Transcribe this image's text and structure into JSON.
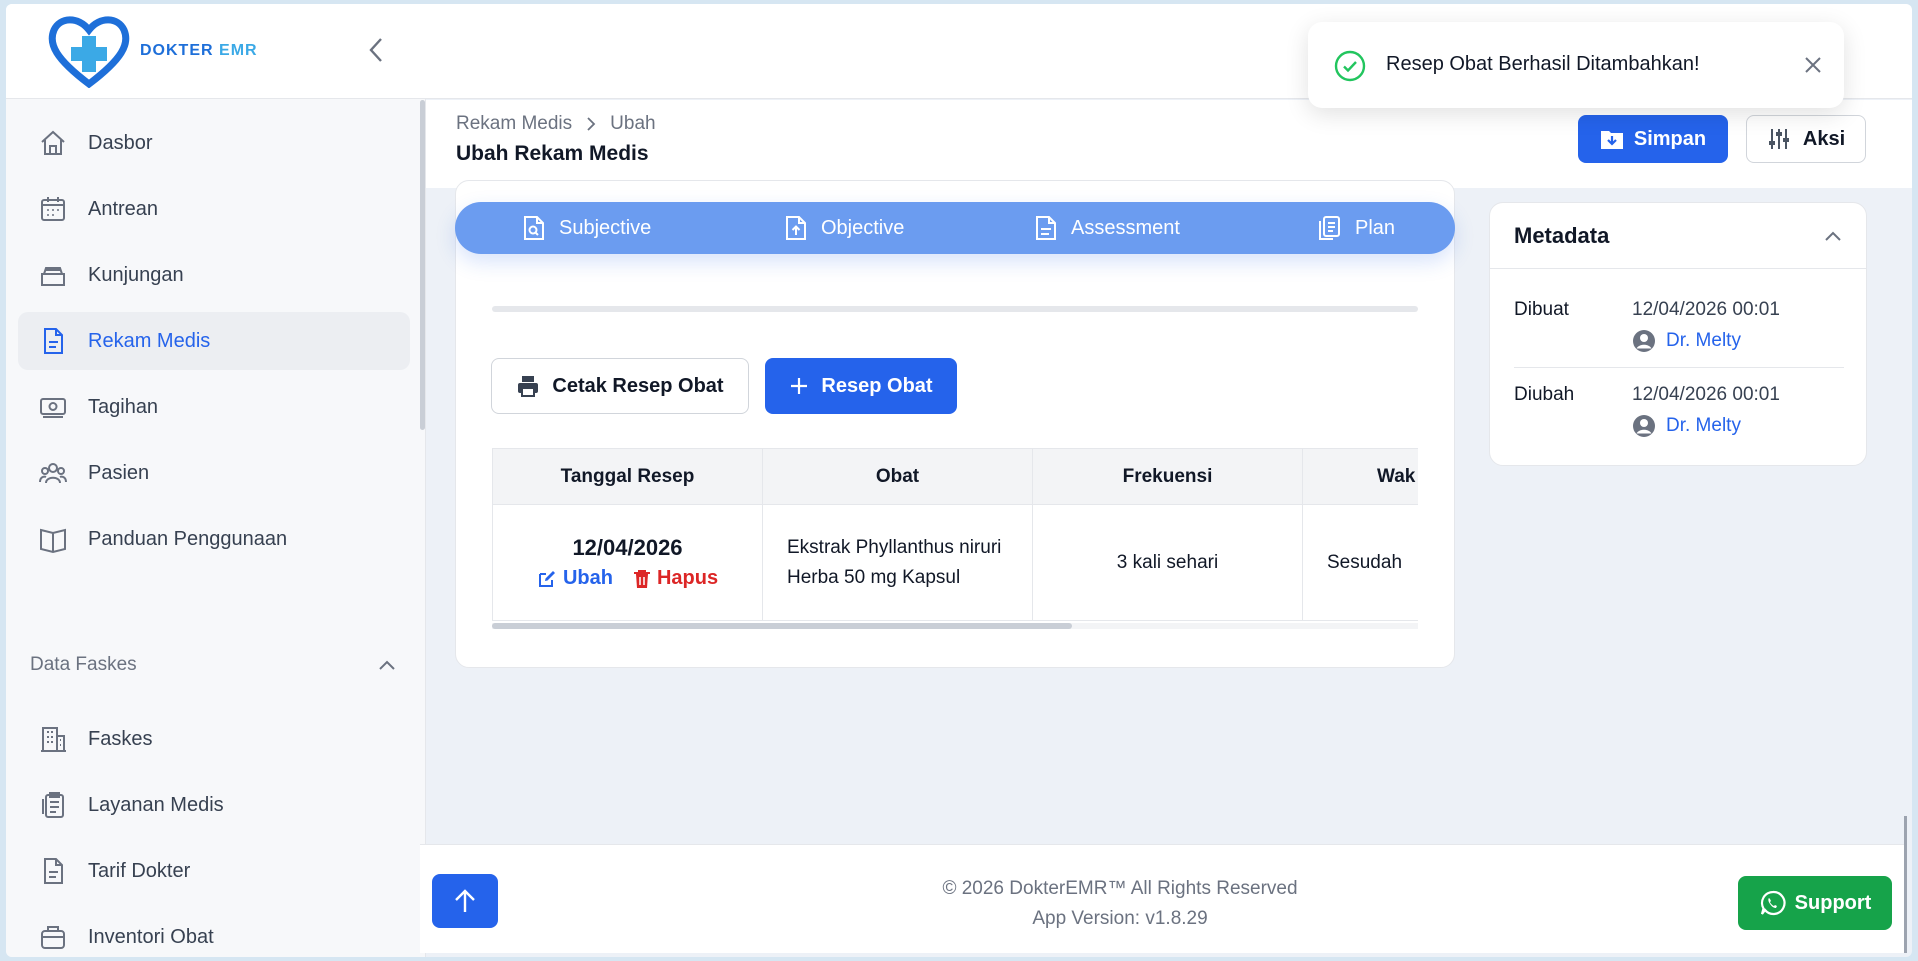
{
  "app": {
    "logo_text_main": "DOKTER",
    "logo_text_accent": "EMR"
  },
  "sidebar": {
    "items": [
      {
        "label": "Dasbor",
        "icon": "home-icon"
      },
      {
        "label": "Antrean",
        "icon": "calendar-icon"
      },
      {
        "label": "Kunjungan",
        "icon": "inbox-icon"
      },
      {
        "label": "Rekam Medis",
        "icon": "document-icon",
        "active": true
      },
      {
        "label": "Tagihan",
        "icon": "money-icon"
      },
      {
        "label": "Pasien",
        "icon": "users-icon"
      },
      {
        "label": "Panduan Penggunaan",
        "icon": "book-icon"
      }
    ],
    "section_label": "Data Faskes",
    "section_items": [
      {
        "label": "Faskes",
        "icon": "building-icon"
      },
      {
        "label": "Layanan Medis",
        "icon": "clipboard-icon"
      },
      {
        "label": "Tarif Dokter",
        "icon": "document-icon"
      },
      {
        "label": "Inventori Obat",
        "icon": "medicine-box-icon"
      }
    ]
  },
  "header": {
    "breadcrumb": [
      "Rekam Medis",
      "Ubah"
    ],
    "title": "Ubah Rekam Medis",
    "save_label": "Simpan",
    "actions_label": "Aksi"
  },
  "soap_tabs": [
    "Subjective",
    "Objective",
    "Assessment",
    "Plan"
  ],
  "prescription": {
    "print_label": "Cetak Resep Obat",
    "add_label": "Resep Obat",
    "columns": [
      "Tanggal Resep",
      "Obat",
      "Frekuensi",
      "Wak"
    ],
    "rows": [
      {
        "date": "12/04/2026",
        "edit_label": "Ubah",
        "delete_label": "Hapus",
        "drug": "Ekstrak Phyllanthus niruri Herba 50 mg Kapsul",
        "frequency": "3 kali sehari",
        "time": "Sesudah"
      }
    ]
  },
  "metadata": {
    "title": "Metadata",
    "created_label": "Dibuat",
    "created_date": "12/04/2026 00:01",
    "created_by": "Dr. Melty",
    "updated_label": "Diubah",
    "updated_date": "12/04/2026 00:01",
    "updated_by": "Dr. Melty"
  },
  "footer": {
    "copyright": "© 2026 DokterEMR™ All Rights Reserved",
    "version": "App Version: v1.8.29",
    "support_label": "Support"
  },
  "toast": {
    "message": "Resep Obat Berhasil Ditambahkan!"
  },
  "colors": {
    "primary": "#2563eb",
    "soap_bar": "#6b9cf0",
    "danger": "#dc2626",
    "success": "#16a34a"
  }
}
